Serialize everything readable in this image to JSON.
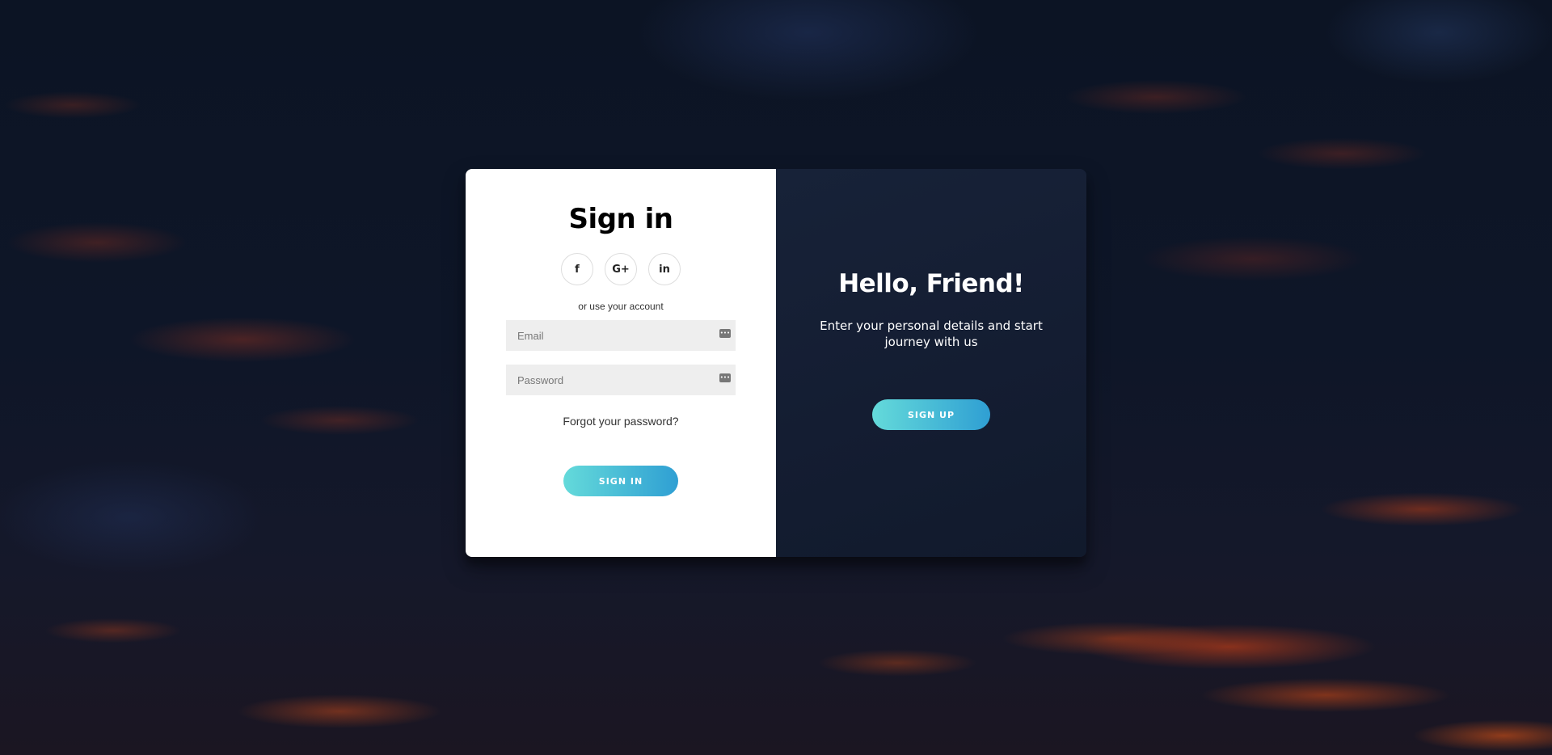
{
  "signin": {
    "title": "Sign in",
    "social": [
      {
        "icon": "facebook-icon",
        "glyph": "f"
      },
      {
        "icon": "google-plus-icon",
        "glyph": "G+"
      },
      {
        "icon": "linkedin-icon",
        "glyph": "in"
      }
    ],
    "alt_text": "or use your account",
    "email_placeholder": "Email",
    "password_placeholder": "Password",
    "forgot_label": "Forgot your password?",
    "button_label": "SIGN IN"
  },
  "overlay": {
    "title": "Hello, Friend!",
    "text": "Enter your personal details and start journey with us",
    "button_label": "SIGN UP"
  },
  "colors": {
    "accent_start": "#64dada",
    "accent_end": "#2f9fd3",
    "overlay_bg": "#141d32",
    "field_bg": "#eeeeee"
  }
}
